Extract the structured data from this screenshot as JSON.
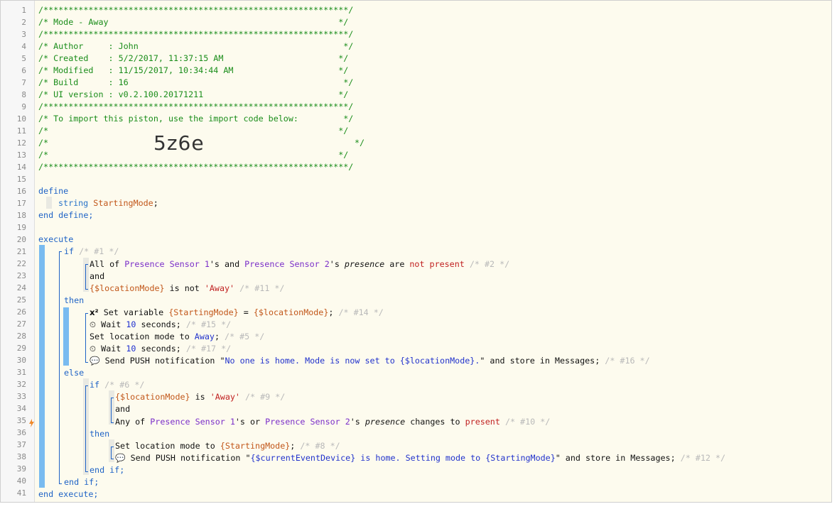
{
  "line_numbers": [
    "1",
    "2",
    "3",
    "4",
    "5",
    "6",
    "7",
    "8",
    "9",
    "10",
    "11",
    "12",
    "13",
    "14",
    "15",
    "16",
    "17",
    "18",
    "19",
    "20",
    "21",
    "22",
    "23",
    "24",
    "25",
    "26",
    "27",
    "28",
    "29",
    "30",
    "31",
    "32",
    "33",
    "34",
    "35",
    "36",
    "37",
    "38",
    "39",
    "40",
    "41"
  ],
  "header": {
    "stars": "/*************************************************************/",
    "title": "/* Mode - Away                                              */",
    "author": "/* Author     : John                                         */",
    "created": "/* Created    : 5/2/2017, 11:37:15 AM                       */",
    "modified": "/* Modified   : 11/15/2017, 10:34:44 AM                     */",
    "build": "/* Build      : 16                                           */",
    "ui_version": "/* UI version : v0.2.100.20171211                           */",
    "import_line": "/* To import this piston, use the import code below:         */",
    "empty_line": "/*                                                          */",
    "empty_left": "/*",
    "empty_right": "*/",
    "import_code": "5z6e"
  },
  "code": {
    "define": "define",
    "string_kw": "string",
    "starting_mode": "StartingMode",
    "semicolon": ";",
    "end_define": "end define;",
    "execute": "execute",
    "if": "if",
    "c1": "/* #1 */",
    "all_of": "All of ",
    "ps1": "Presence Sensor 1",
    "s_and": "'s and ",
    "ps2": "Presence Sensor 2",
    "s_sp": "'s ",
    "presence": "presence",
    "are": " are ",
    "not_present": "not present",
    "c2": "/* #2 */",
    "and": "and",
    "location_mode": "{$locationMode}",
    "is_not": " is not ",
    "away_str": "'Away'",
    "c11": "/* #11 */",
    "then": "then",
    "x2": "x²",
    "set_variable": " Set variable ",
    "starting_mode_var": "{StartingMode}",
    "eq": " = ",
    "c14": "/* #14 */",
    "clock": "⏲",
    "wait": " Wait ",
    "ten": "10",
    "seconds": " seconds;",
    "c15": "/* #15 */",
    "set_location_mode_to": "Set location mode to ",
    "away": "Away",
    "c5": "/* #5 */",
    "c17": "/* #17 */",
    "speech": "💬",
    "send_push": " Send PUSH notification \"",
    "msg1": "No one is home. Mode is now set to {$locationMode}.",
    "store_msgs": "\" and store in Messages;",
    "c16": "/* #16 */",
    "else": "else",
    "c6": "/* #6 */",
    "is": " is ",
    "c9": "/* #9 */",
    "any_of": "Any of ",
    "s_or": "'s or ",
    "changes_to": " changes to ",
    "present": "present",
    "c10": "/* #10 */",
    "c8": "/* #8 */",
    "msg2_open": " Send PUSH notification \"",
    "current_event_device": "{$currentEventDevice}",
    "msg2_mid": " is home. Setting mode to ",
    "c12": "/* #12 */",
    "end_if": "end if;",
    "end_execute": "end execute;"
  },
  "colors": {
    "comment": "#1a8d1a",
    "keyword": "#1f63c6",
    "device": "#7b2fc9",
    "variable": "#c2571a",
    "string": "#c01f1f",
    "number": "#1f2fd0",
    "bar": "#79bbf0",
    "background": "#fdfbee"
  }
}
